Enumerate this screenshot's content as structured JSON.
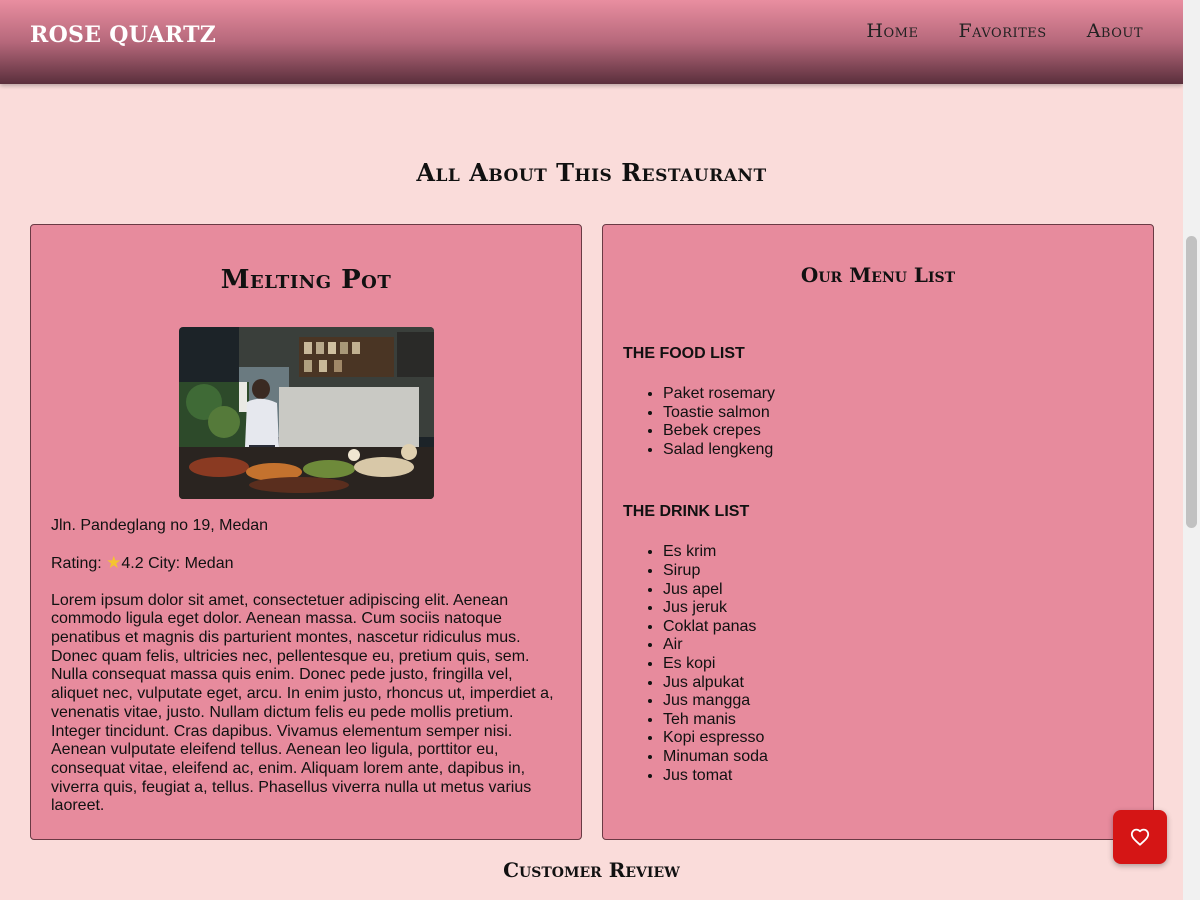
{
  "navbar": {
    "brand": "ROSE QUARTZ",
    "links": [
      "Home",
      "Favorites",
      "About"
    ]
  },
  "page": {
    "section_title": "All About This Restaurant",
    "review_title": "Customer Review"
  },
  "restaurant": {
    "name": "Melting Pot",
    "address": "Jln. Pandeglang no 19, Medan",
    "rating_label": "Rating:",
    "rating_value": "4.2",
    "city_label": "City:",
    "city": "Medan",
    "description": "Lorem ipsum dolor sit amet, consectetuer adipiscing elit. Aenean commodo ligula eget dolor. Aenean massa. Cum sociis natoque penatibus et magnis dis parturient montes, nascetur ridiculus mus. Donec quam felis, ultricies nec, pellentesque eu, pretium quis, sem. Nulla consequat massa quis enim. Donec pede justo, fringilla vel, aliquet nec, vulputate eget, arcu. In enim justo, rhoncus ut, imperdiet a, venenatis vitae, justo. Nullam dictum felis eu pede mollis pretium. Integer tincidunt. Cras dapibus. Vivamus elementum semper nisi. Aenean vulputate eleifend tellus. Aenean leo ligula, porttitor eu, consequat vitae, eleifend ac, enim. Aliquam lorem ante, dapibus in, viverra quis, feugiat a, tellus. Phasellus viverra nulla ut metus varius laoreet."
  },
  "menu": {
    "title": "Our Menu List",
    "food_heading": "THE FOOD LIST",
    "foods": [
      "Paket rosemary",
      "Toastie salmon",
      "Bebek crepes",
      "Salad lengkeng"
    ],
    "drink_heading": "THE DRINK LIST",
    "drinks": [
      "Es krim",
      "Sirup",
      "Jus apel",
      "Jus jeruk",
      "Coklat panas",
      "Air",
      "Es kopi",
      "Jus alpukat",
      "Jus mangga",
      "Teh manis",
      "Kopi espresso",
      "Minuman soda",
      "Jus tomat"
    ]
  },
  "icons": {
    "rating": "star-icon",
    "favorite": "heart-icon"
  },
  "colors": {
    "page_bg": "#fadcda",
    "card_bg": "#e78b9d",
    "favorite_button": "#d51515"
  }
}
